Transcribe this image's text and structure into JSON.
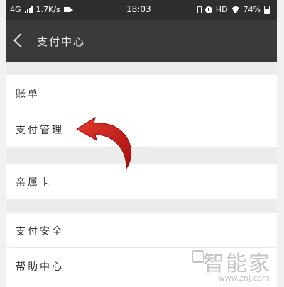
{
  "status_bar": {
    "network": "4G",
    "speed": "1.7K/s",
    "time": "18:03",
    "hd": "HD",
    "battery": "74%"
  },
  "nav": {
    "title": "支付中心"
  },
  "menu": {
    "bill": "账单",
    "payment_management": "支付管理",
    "family_card": "亲属卡",
    "payment_security": "支付安全",
    "help_center": "帮助中心"
  },
  "watermark": {
    "brand": "智能家",
    "url": "www.znj.com"
  },
  "colors": {
    "status_bg": "#2e2e2e",
    "nav_bg": "#3a3a3a",
    "arrow": "#c81e1e"
  }
}
